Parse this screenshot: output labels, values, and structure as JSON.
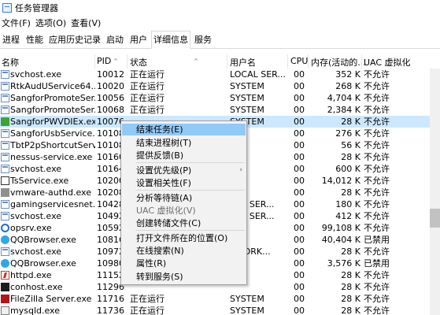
{
  "window": {
    "title": "任务管理器"
  },
  "menu": {
    "file": "文件(F)",
    "options": "选项(O)",
    "view": "查看(V)"
  },
  "tabs": [
    {
      "label": "进程"
    },
    {
      "label": "性能"
    },
    {
      "label": "应用历史记录"
    },
    {
      "label": "启动"
    },
    {
      "label": "用户"
    },
    {
      "label": "详细信息"
    },
    {
      "label": "服务"
    }
  ],
  "columns": {
    "name": "名称",
    "pid": "PID",
    "status": "状态",
    "user": "用户名",
    "cpu": "CPU",
    "memory": "内存(活动的...",
    "uac": "UAC 虚拟化"
  },
  "rows": [
    {
      "icon": "window-icon",
      "name": "svchost.exe",
      "pid": "10012",
      "status": "正在运行",
      "user": "LOCAL SER...",
      "cpu": "00",
      "mem": "352 K",
      "uac": "不允许"
    },
    {
      "icon": "window-icon",
      "name": "RtkAudUService64....",
      "pid": "10020",
      "status": "正在运行",
      "user": "SYSTEM",
      "cpu": "00",
      "mem": "268 K",
      "uac": "不允许"
    },
    {
      "icon": "window-icon",
      "name": "SangforPromoteSer...",
      "pid": "10056",
      "status": "正在运行",
      "user": "SYSTEM",
      "cpu": "00",
      "mem": "4,704 K",
      "uac": "不允许"
    },
    {
      "icon": "window-icon",
      "name": "SangforPromoteSer...",
      "pid": "10068",
      "status": "正在运行",
      "user": "SYSTEM",
      "cpu": "00",
      "mem": "2,384 K",
      "uac": "不允许"
    },
    {
      "icon": "green-app-icon",
      "name": "SangforPWVDIEx.exe",
      "pid": "10076",
      "status": "",
      "user": "SYSTEM",
      "cpu": "00",
      "mem": "28 K",
      "uac": "不允许"
    },
    {
      "icon": "window-icon",
      "name": "SangforUsbService...",
      "pid": "10108",
      "status": "",
      "user": "",
      "cpu": "00",
      "mem": "276 K",
      "uac": "不允许"
    },
    {
      "icon": "window-icon",
      "name": "TbtP2pShortcutServ...",
      "pid": "10108",
      "status": "",
      "user": "",
      "cpu": "00",
      "mem": "56 K",
      "uac": "不允许"
    },
    {
      "icon": "window-icon",
      "name": "nessus-service.exe",
      "pid": "10160",
      "status": "",
      "user": "",
      "cpu": "00",
      "mem": "28 K",
      "uac": "不允许"
    },
    {
      "icon": "window-icon",
      "name": "svchost.exe",
      "pid": "10164",
      "status": "",
      "user": "",
      "cpu": "00",
      "mem": "600 K",
      "uac": "不允许"
    },
    {
      "icon": "ts-icon",
      "name": "TsService.exe",
      "pid": "10200",
      "status": "",
      "user": "",
      "cpu": "00",
      "mem": "14,012 K",
      "uac": "不允许"
    },
    {
      "icon": "vmware-icon",
      "name": "vmware-authd.exe",
      "pid": "10208",
      "status": "",
      "user": "",
      "cpu": "00",
      "mem": "28 K",
      "uac": "不允许"
    },
    {
      "icon": "window-icon",
      "name": "gamingservicesnet....",
      "pid": "10428",
      "status": "",
      "user": "CAL SER...",
      "cpu": "00",
      "mem": "180 K",
      "uac": "不允许"
    },
    {
      "icon": "window-icon",
      "name": "svchost.exe",
      "pid": "10492",
      "status": "",
      "user": "CAL SER...",
      "cpu": "00",
      "mem": "412 K",
      "uac": "不允许"
    },
    {
      "icon": "opsrv-icon",
      "name": "opsrv.exe",
      "pid": "10592",
      "status": "",
      "user": "",
      "cpu": "00",
      "mem": "99,108 K",
      "uac": "不允许"
    },
    {
      "icon": "qqbrowser-icon",
      "name": "QQBrowser.exe",
      "pid": "10816",
      "status": "",
      "user": "36",
      "cpu": "00",
      "mem": "40,404 K",
      "uac": "已禁用"
    },
    {
      "icon": "window-icon",
      "name": "svchost.exe",
      "pid": "10972",
      "status": "",
      "user": "TWORK...",
      "cpu": "00",
      "mem": "28 K",
      "uac": "不允许"
    },
    {
      "icon": "qqbrowser-icon",
      "name": "QQBrowser.exe",
      "pid": "10980",
      "status": "",
      "user": "36",
      "cpu": "00",
      "mem": "3,576 K",
      "uac": "已禁用"
    },
    {
      "icon": "httpd-icon",
      "name": "httpd.exe",
      "pid": "11152",
      "status": "",
      "user": "",
      "cpu": "00",
      "mem": "28 K",
      "uac": "不允许"
    },
    {
      "icon": "console-icon",
      "name": "conhost.exe",
      "pid": "11296",
      "status": "",
      "user": "",
      "cpu": "00",
      "mem": "28 K",
      "uac": "不允许"
    },
    {
      "icon": "filezilla-icon",
      "name": "FileZilla Server.exe",
      "pid": "11716",
      "status": "正在运行",
      "user": "SYSTEM",
      "cpu": "00",
      "mem": "28 K",
      "uac": "不允许"
    },
    {
      "icon": "mysql-icon",
      "name": "mysqld.exe",
      "pid": "11736",
      "status": "正在运行",
      "user": "SYSTEM",
      "cpu": "00",
      "mem": "28 K",
      "uac": "不允许"
    }
  ],
  "selected_row": 4,
  "context_menu": [
    {
      "label": "结束任务(E)"
    },
    {
      "label": "结束进程树(T)"
    },
    {
      "label": "提供反馈(B)"
    },
    {
      "label": "设置优先级(P)",
      "arrow": "›"
    },
    {
      "label": "设置相关性(F)"
    },
    {
      "label": "分析等待链(A)"
    },
    {
      "label": "UAC 虚拟化(V)",
      "disabled": true
    },
    {
      "label": "创建转储文件(C)"
    },
    {
      "label": "打开文件所在的位置(O)"
    },
    {
      "label": "在线搜索(N)"
    },
    {
      "label": "属性(R)"
    },
    {
      "label": "转到服务(S)"
    }
  ],
  "colors": {
    "selection": "#cce8ff",
    "menu_hover": "#91c9f7",
    "menu_bg": "#f2f2f2"
  }
}
